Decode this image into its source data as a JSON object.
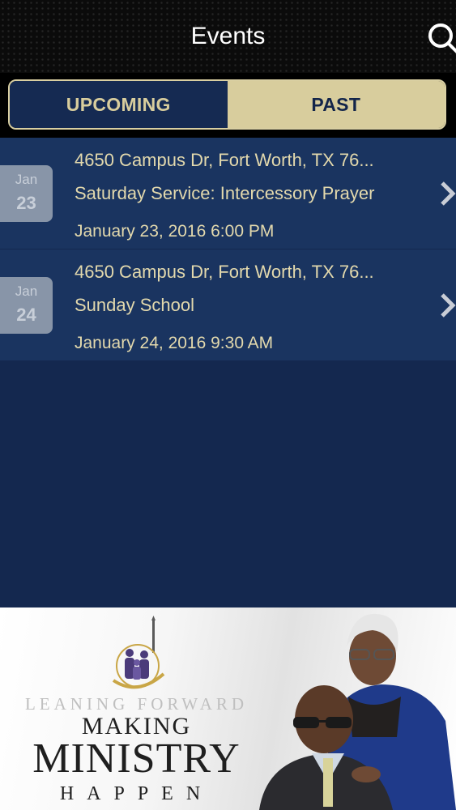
{
  "header": {
    "title": "Events"
  },
  "icons": {
    "search": "search-icon",
    "chevron": "chevron-right-icon"
  },
  "tabs": [
    {
      "label": "UPCOMING",
      "selected": false
    },
    {
      "label": "PAST",
      "selected": true
    }
  ],
  "events": [
    {
      "month": "Jan",
      "day": "23",
      "address": "4650 Campus Dr, Fort Worth, TX 76...",
      "name": "Saturday Service: Intercessory Prayer",
      "datetime": "January 23, 2016 6:00 PM"
    },
    {
      "month": "Jan",
      "day": "24",
      "address": "4650 Campus Dr, Fort Worth, TX 76...",
      "name": "Sunday School",
      "datetime": "January 24, 2016 9:30 AM"
    }
  ],
  "banner": {
    "leaning_text": "LEANING FORWARD",
    "making_text": "MAKING",
    "ministry_text": "MINISTRY",
    "happen_text": "HAPPEN"
  },
  "colors": {
    "header_bg": "#0b0b0b",
    "list_bg": "#14284f",
    "row_bg": "#1a3460",
    "gold": "#d8cd9d",
    "row_text": "#e3d9ad",
    "badge_bg": "#8895a8"
  }
}
